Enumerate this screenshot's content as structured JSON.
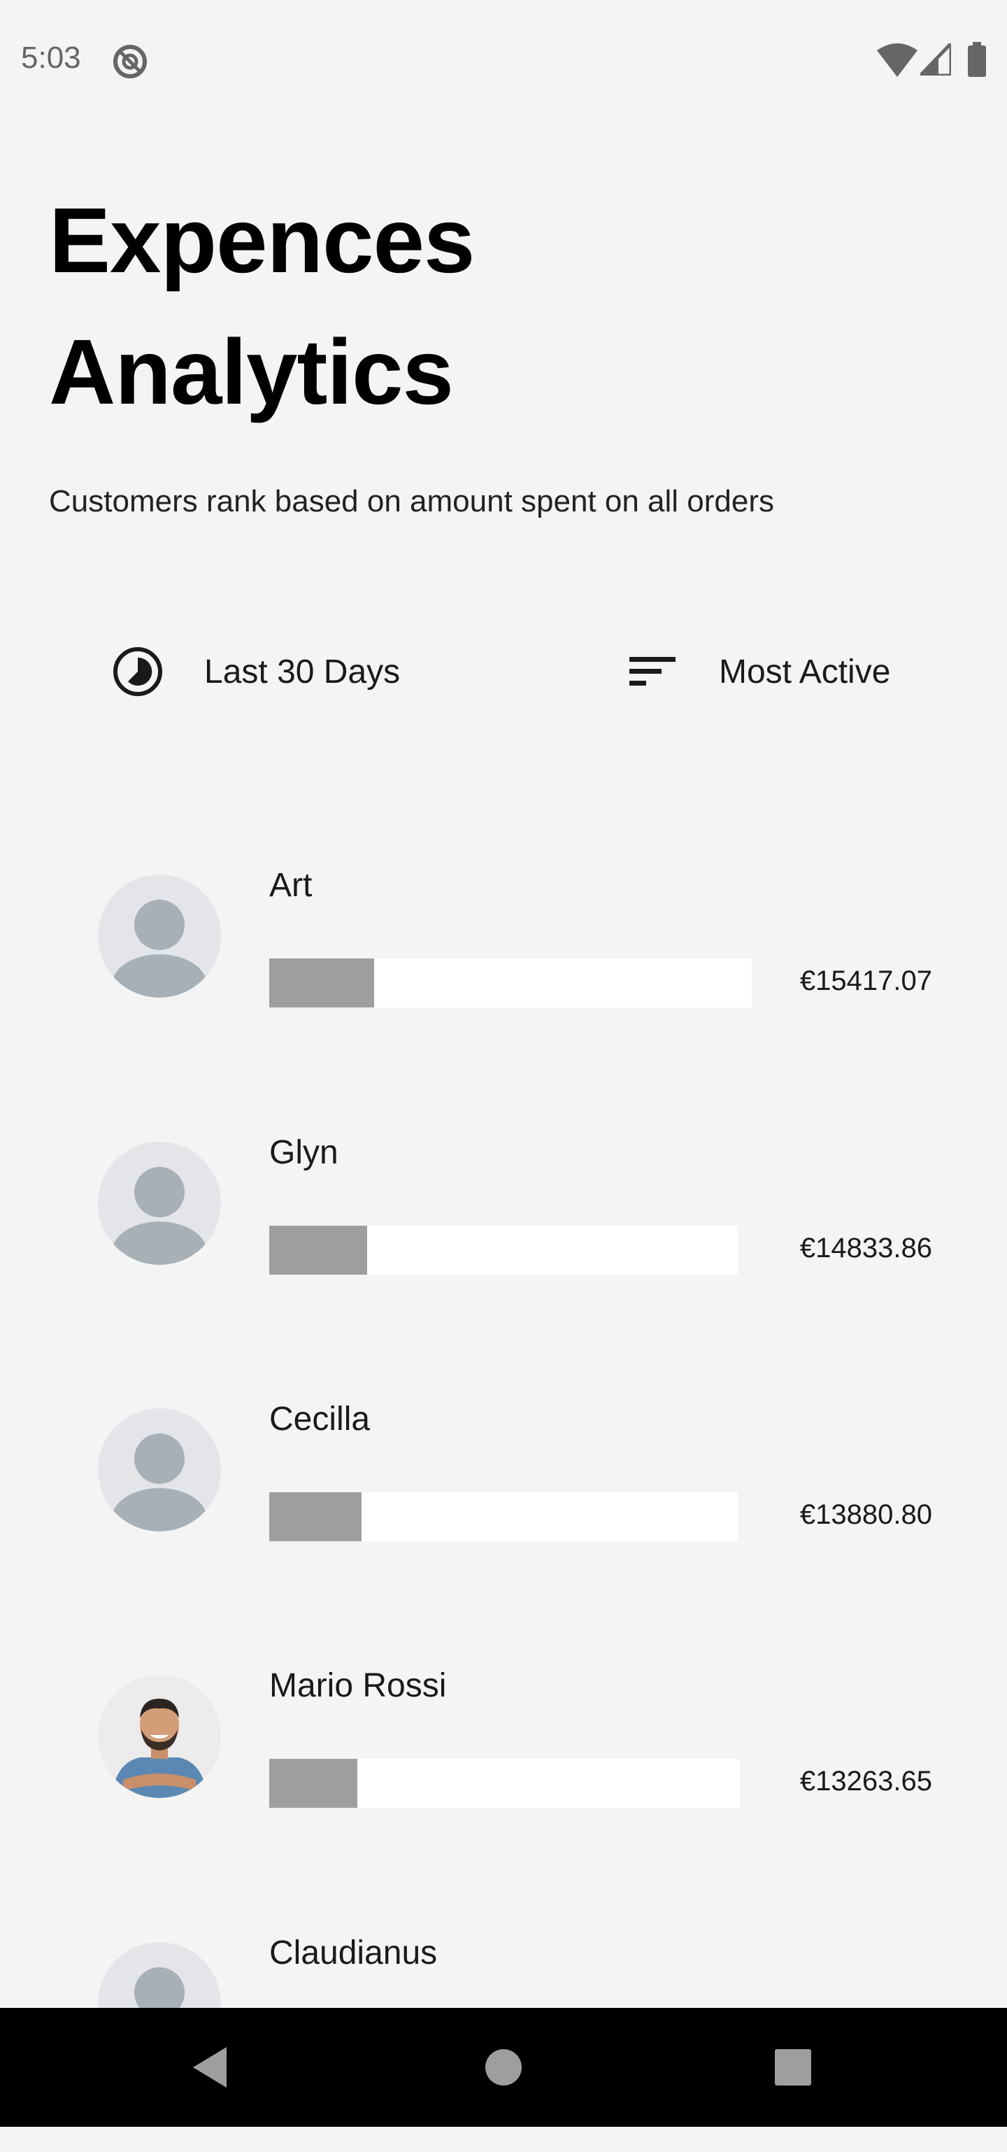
{
  "status_bar": {
    "time": "5:03",
    "icons": [
      "do-not-disturb-icon",
      "wifi-icon",
      "cell-signal-icon",
      "battery-icon"
    ]
  },
  "header": {
    "title_line1": "Expences",
    "title_line2": "Analytics",
    "subtitle": "Customers rank based on amount spent on all orders"
  },
  "filters": {
    "period": {
      "icon": "clock-pie-icon",
      "label": "Last 30 Days"
    },
    "sort": {
      "icon": "sort-lines-icon",
      "label": "Most Active"
    }
  },
  "customers": [
    {
      "name": "Art",
      "amount": "€15417.07",
      "bar_fill_fraction": 0.22,
      "avatar": "default-person-icon"
    },
    {
      "name": "Glyn",
      "amount": "€14833.86",
      "bar_fill_fraction": 0.21,
      "avatar": "default-person-icon"
    },
    {
      "name": "Cecilla",
      "amount": "€13880.80",
      "bar_fill_fraction": 0.2,
      "avatar": "default-person-icon"
    },
    {
      "name": "Mario Rossi",
      "amount": "€13263.65",
      "bar_fill_fraction": 0.19,
      "avatar": "photo"
    },
    {
      "name": "Claudianus",
      "amount": "",
      "bar_fill_fraction": null,
      "avatar": "default-person-icon"
    }
  ],
  "nav_bar": {
    "buttons": [
      "back-icon",
      "home-icon",
      "recents-icon"
    ]
  },
  "colors": {
    "background": "#f4f4f4",
    "bar_fill": "#9e9e9e",
    "bar_track": "#ffffff",
    "avatar_bg": "#e3e5e8",
    "avatar_glyph": "#a7b0b6",
    "nav_bar": "#000000"
  }
}
